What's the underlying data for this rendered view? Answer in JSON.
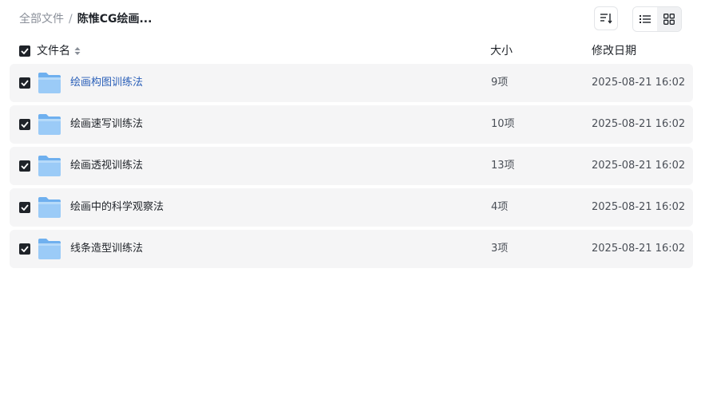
{
  "breadcrumb": {
    "root": "全部文件",
    "separator": "/",
    "current": "陈惟CG绘画..."
  },
  "toolbar": {
    "sort_icon": "sort-icon",
    "list_view_icon": "list-view-icon",
    "grid_view_icon": "grid-view-icon",
    "active_view": "list"
  },
  "table": {
    "headers": {
      "name": "文件名",
      "size": "大小",
      "modified": "修改日期"
    },
    "rows": [
      {
        "name": "绘画构图训练法",
        "size": "9项",
        "modified": "2025-08-21 16:02",
        "checked": true
      },
      {
        "name": "绘画速写训练法",
        "size": "10项",
        "modified": "2025-08-21 16:02",
        "checked": true
      },
      {
        "name": "绘画透视训练法",
        "size": "13项",
        "modified": "2025-08-21 16:02",
        "checked": true
      },
      {
        "name": "绘画中的科学观察法",
        "size": "4项",
        "modified": "2025-08-21 16:02",
        "checked": true
      },
      {
        "name": "线条造型训练法",
        "size": "3项",
        "modified": "2025-08-21 16:02",
        "checked": true
      }
    ]
  },
  "colors": {
    "link": "#2a5fb8",
    "row_bg": "#f5f5f6",
    "checkbox": "#1f2329",
    "folder": "#8fc4f5"
  }
}
